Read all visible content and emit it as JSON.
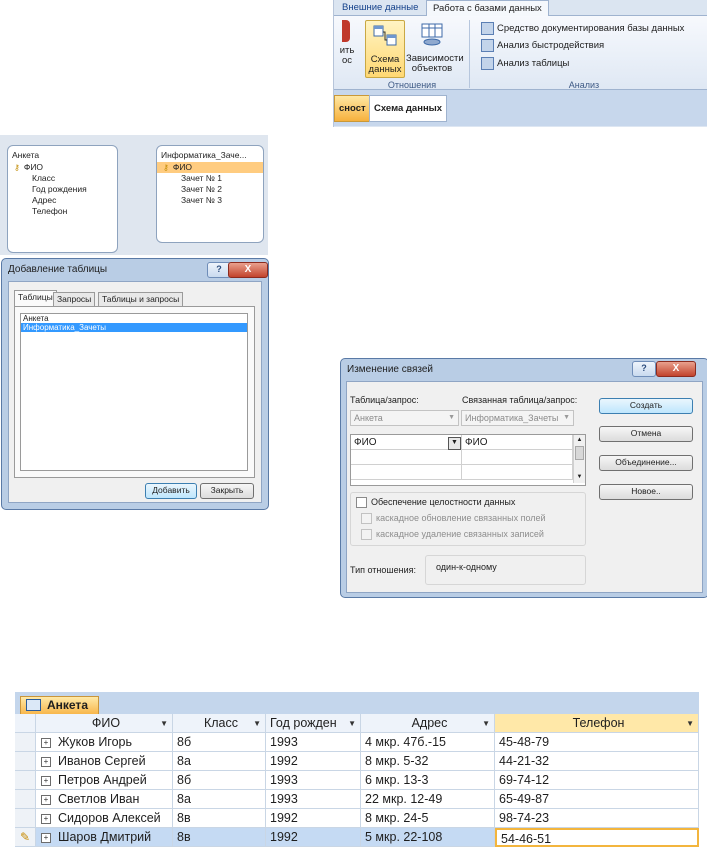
{
  "ribbon": {
    "tabs": [
      "Внешние данные",
      "Работа с базами данных"
    ],
    "active_tab": "Работа с базами данных",
    "partial_button": [
      "ить",
      "ос"
    ],
    "buttons": [
      {
        "label_line1": "Схема",
        "label_line2": "данных",
        "icon": "relationships-icon"
      },
      {
        "label_line1": "Зависимости",
        "label_line2": "объектов",
        "icon": "dependencies-icon"
      }
    ],
    "small_buttons": [
      "Средство документирования базы данных",
      "Анализ быстродействия",
      "Анализ таблицы"
    ],
    "groups": [
      "Отношения",
      "Анализ"
    ]
  },
  "doc_tabs": {
    "partial": "сност",
    "active": "Схема данных"
  },
  "relationships": {
    "table1": {
      "title": "Анкета",
      "fields": [
        "ФИО",
        "Класс",
        "Год рождения",
        "Адрес",
        "Телефон"
      ]
    },
    "table2": {
      "title": "Информатика_Заче...",
      "fields": [
        "ФИО",
        "Зачет № 1",
        "Зачет № 2",
        "Зачет № 3"
      ]
    }
  },
  "add_table": {
    "title": "Добавление таблицы",
    "tabs": [
      "Таблицы",
      "Запросы",
      "Таблицы и запросы"
    ],
    "items": [
      "Анкета",
      "Информатика_Зачеты"
    ],
    "selected_index": 1,
    "add_label": "Добавить",
    "close_label": "Закрыть",
    "help_glyph": "?",
    "close_glyph": "X"
  },
  "edit_relations": {
    "title": "Изменение связей",
    "table_label": "Таблица/запрос:",
    "related_label": "Связанная таблица/запрос:",
    "table_value": "Анкета",
    "related_value": "Информатика_Зачеты",
    "field_left": "ФИО",
    "field_right": "ФИО",
    "integrity": "Обеспечение целостности данных",
    "cascade_update": "каскадное обновление связанных полей",
    "cascade_delete": "каскадное удаление связанных записей",
    "rel_type_label": "Тип отношения:",
    "rel_type_value": "один-к-одному",
    "buttons": {
      "create": "Создать",
      "cancel": "Отмена",
      "join": "Объединение...",
      "new": "Новое.."
    },
    "help_glyph": "?",
    "close_glyph": "X"
  },
  "datasheet": {
    "tab": "Анкета",
    "columns": [
      "ФИО",
      "Класс",
      "Год рожден",
      "Адрес",
      "Телефон"
    ],
    "rows": [
      [
        "Жуков Игорь",
        "8б",
        "1993",
        "4 мкр. 47б.-15",
        "45-48-79"
      ],
      [
        "Иванов Сергей",
        "8а",
        "1992",
        "8 мкр. 5-32",
        "44-21-32"
      ],
      [
        "Петров Андрей",
        "8б",
        "1993",
        "6 мкр. 13-3",
        "69-74-12"
      ],
      [
        "Светлов Иван",
        "8а",
        "1993",
        "22 мкр. 12-49",
        "65-49-87"
      ],
      [
        "Сидоров Алексей",
        "8в",
        "1992",
        "8 мкр. 24-5",
        "98-74-23"
      ],
      [
        "Шаров Дмитрий",
        "8в",
        "1992",
        "5 мкр. 22-108",
        "54-46-51"
      ]
    ],
    "current_row": 5
  }
}
